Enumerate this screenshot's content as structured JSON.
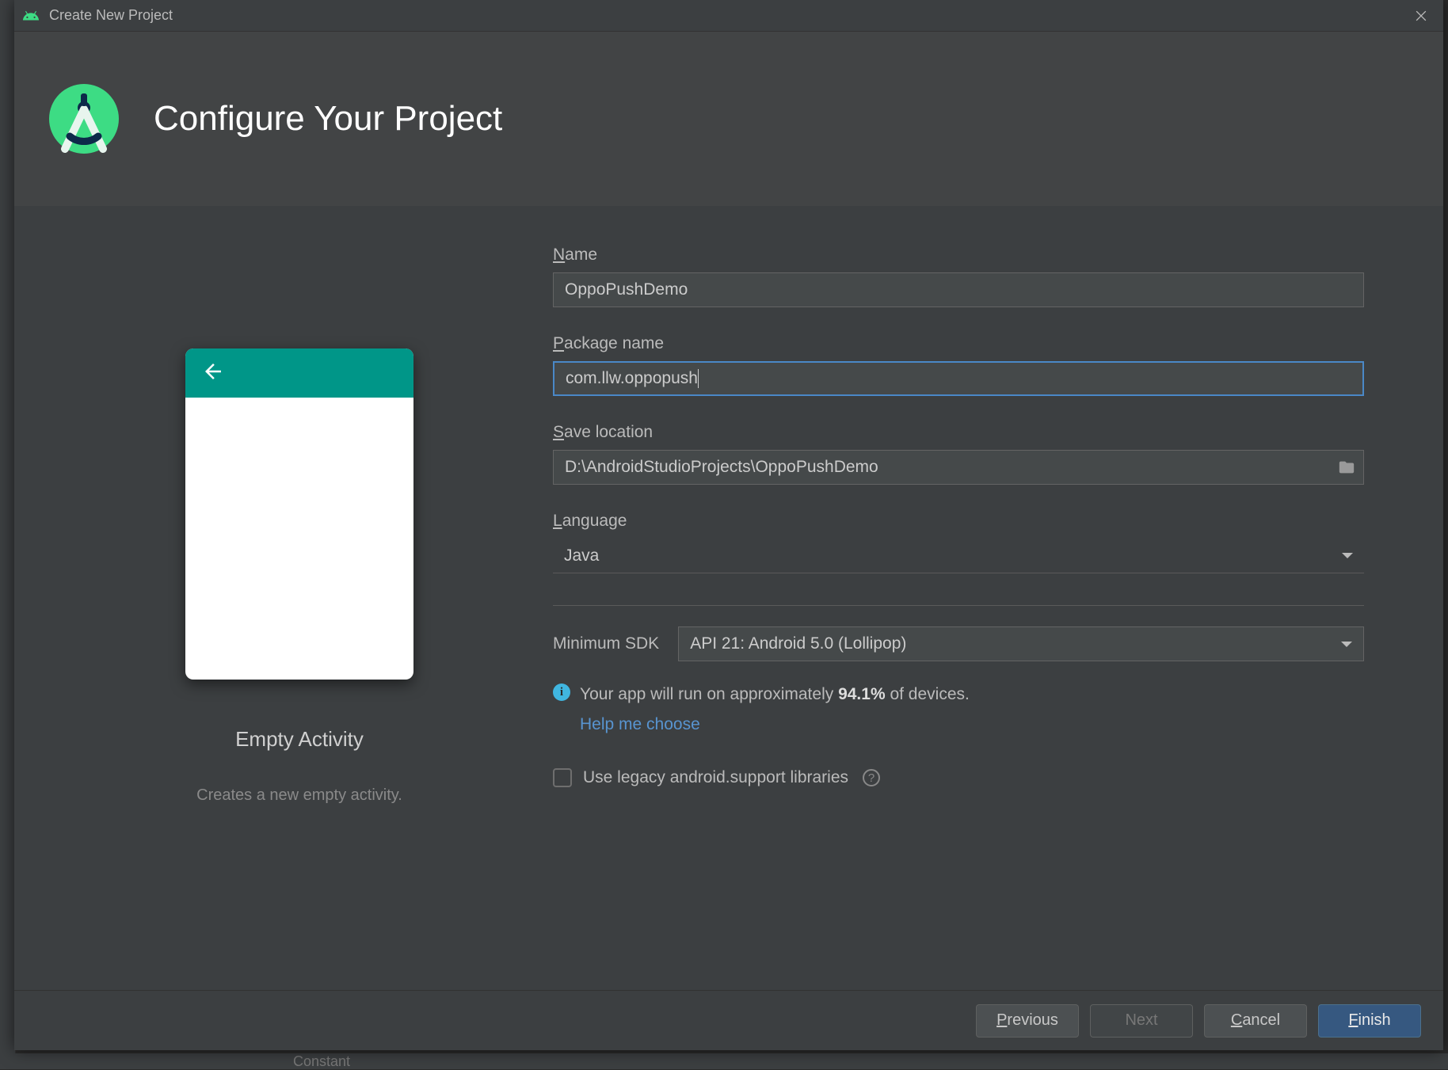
{
  "titlebar": {
    "title": "Create New Project"
  },
  "header": {
    "heading": "Configure Your Project"
  },
  "preview": {
    "title": "Empty Activity",
    "description": "Creates a new empty activity."
  },
  "form": {
    "name_label": "Name",
    "name_mnemonic": "N",
    "name_value": "OppoPushDemo",
    "package_label": "Package name",
    "package_mnemonic": "P",
    "package_value": "com.llw.oppopush",
    "save_label": "Save location",
    "save_mnemonic": "S",
    "save_value": "D:\\AndroidStudioProjects\\OppoPushDemo",
    "language_label": "Language",
    "language_mnemonic": "L",
    "language_value": "Java",
    "min_sdk_label": "Minimum SDK",
    "min_sdk_value": "API 21: Android 5.0 (Lollipop)",
    "run_info_prefix": "Your app will run on approximately ",
    "run_info_pct": "94.1%",
    "run_info_suffix": " of devices.",
    "help_link": "Help me choose",
    "legacy_label": "Use legacy android.support libraries"
  },
  "footer": {
    "previous": "Previous",
    "next": "Next",
    "cancel": "Cancel",
    "finish": "Finish"
  },
  "bg_text": "Constant"
}
